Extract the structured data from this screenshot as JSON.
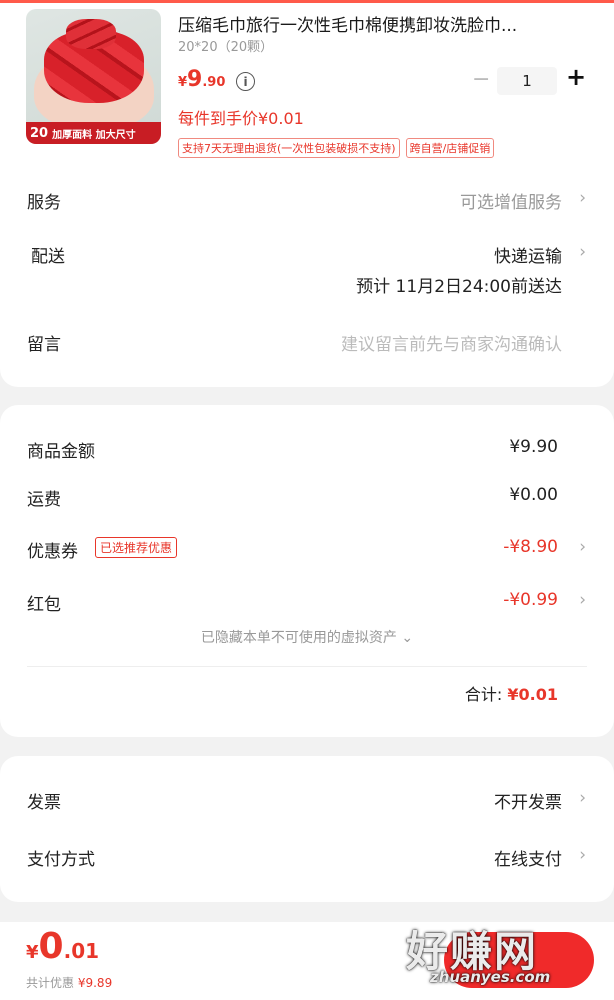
{
  "product": {
    "title": "压缩毛巾旅行一次性毛巾棉便携卸妆洗脸巾...",
    "spec": "20*20（20颗）",
    "image_banner_count": "20",
    "image_banner_text": "加厚面料 加大尺寸",
    "price_currency": "¥",
    "price_int": "9",
    "price_dec": ".90",
    "quantity": "1",
    "each_price": "每件到手价¥0.01",
    "tags": [
      "支持7天无理由退货(一次性包装破损不支持)",
      "跨自营/店铺促销"
    ]
  },
  "options": {
    "service_label": "服务",
    "service_value": "可选增值服务",
    "delivery_label": "配送",
    "delivery_value": "快递运输",
    "delivery_eta": "预计 11月2日24:00前送达",
    "message_label": "留言",
    "message_placeholder": "建议留言前先与商家沟通确认"
  },
  "summary": {
    "goods_label": "商品金额",
    "goods_value": "¥9.90",
    "shipping_label": "运费",
    "shipping_value": "¥0.00",
    "coupon_label": "优惠券",
    "coupon_tag": "已选推荐优惠",
    "coupon_value": "-¥8.90",
    "redpack_label": "红包",
    "redpack_value": "-¥0.99",
    "hidden_assets": "已隐藏本单不可使用的虚拟资产",
    "total_label": "合计:",
    "total_value": "¥0.01"
  },
  "invoice": {
    "invoice_label": "发票",
    "invoice_value": "不开发票",
    "payment_label": "支付方式",
    "payment_value": "在线支付"
  },
  "bottom": {
    "currency": "¥",
    "amount_int": "0",
    "amount_dec": ".01",
    "discount_label": "共计优惠",
    "discount_value": "¥9.89"
  },
  "watermark": {
    "big": "好赚网",
    "small": "zhuanyes.com"
  },
  "colors": {
    "accent": "#e8362a",
    "background": "#f2f2f2"
  }
}
